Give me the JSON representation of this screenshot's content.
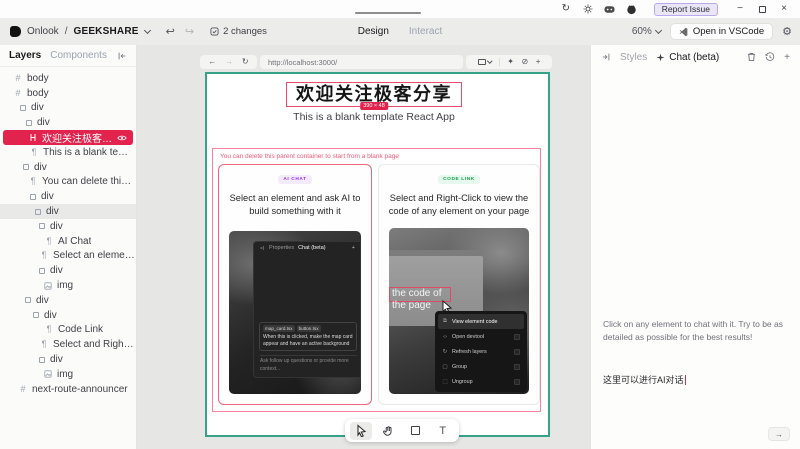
{
  "colors": {
    "accent_red": "#e2234e",
    "frame_teal": "#36a28a",
    "ai_chat_purple": "#9333ea",
    "code_link_green": "#16a34a"
  },
  "glyphs": {
    "minus": "−",
    "close": "×",
    "undo": "↩",
    "redo": "↪",
    "refresh": "↻",
    "ban": "⊘",
    "sparkle": "✦",
    "gear": "⚙",
    "plus": "+",
    "arrow_right": "→",
    "arrow_left": "←",
    "hash": "#",
    "pilcrow": "¶",
    "tri_up": "▲",
    "letter_t": "T",
    "slash": "/"
  },
  "titlebar": {
    "report_issue_label": "Report Issue"
  },
  "header": {
    "brand": "Onlook",
    "project": "GEEKSHARE",
    "changes_label": "2 changes",
    "tabs": {
      "design": "Design",
      "interact": "Interact"
    },
    "zoom_level": "60%",
    "open_vscode_label": "Open in VSCode"
  },
  "sidebar": {
    "tabs": {
      "layers": "Layers",
      "components": "Components"
    },
    "tree": [
      {
        "type": "hash",
        "label": "body"
      },
      {
        "type": "hash",
        "label": "body"
      },
      {
        "type": "element",
        "label": "div"
      },
      {
        "type": "element",
        "label": "div"
      },
      {
        "type": "heading",
        "label": "欢迎关注极客分享",
        "selected": true
      },
      {
        "type": "text",
        "label": "This is a blank template R..."
      },
      {
        "type": "element",
        "label": "div"
      },
      {
        "type": "text",
        "label": "You can delete this paren..."
      },
      {
        "type": "element",
        "label": "div"
      },
      {
        "type": "element",
        "label": "div",
        "highlighted": true
      },
      {
        "type": "element",
        "label": "div"
      },
      {
        "type": "text",
        "label": "AI Chat"
      },
      {
        "type": "text",
        "label": "Select an element and..."
      },
      {
        "type": "element",
        "label": "div"
      },
      {
        "type": "image",
        "label": "img"
      },
      {
        "type": "element",
        "label": "div"
      },
      {
        "type": "element",
        "label": "div"
      },
      {
        "type": "text",
        "label": "Code Link"
      },
      {
        "type": "text",
        "label": "Select and Right-Click..."
      },
      {
        "type": "element",
        "label": "div"
      },
      {
        "type": "image",
        "label": "img"
      },
      {
        "type": "hash",
        "label": "next-route-announcer"
      }
    ]
  },
  "canvas": {
    "browser": {
      "url": "http://localhost:3000/"
    },
    "page": {
      "title": "欢迎关注极客分享",
      "size_badge": "390 × 48",
      "subtitle": "This is a blank template React App",
      "warning": "You can delete this parent container to start from a blank page",
      "cards": [
        {
          "badge": "AI CHAT",
          "heading": "Select an element and ask AI to build something with it",
          "screenshot": {
            "properties_tab": "Properties",
            "chat_tab": "Chat (beta)",
            "chips": [
              "map_card.tsx",
              "button.tsx"
            ],
            "message": "When this is clicked, make the map card appear and have an active background",
            "placeholder": "Ask follow up questions or provide more context..."
          }
        },
        {
          "badge": "CODE LINK",
          "heading": "Select and Right-Click to view the code of any element on your page",
          "screenshot": {
            "selection_text": "the code of\nthe page",
            "menu": [
              "View element code",
              "Open devtool",
              "Refresh layers",
              "Group",
              "Ungroup"
            ]
          }
        }
      ]
    }
  },
  "right_panel": {
    "tabs": {
      "styles": "Styles",
      "chat": "Chat (beta)"
    },
    "message": "Click on any element to chat with it. Try to be as detailed as possible for the best results!",
    "input_value": "这里可以进行AI对话"
  }
}
